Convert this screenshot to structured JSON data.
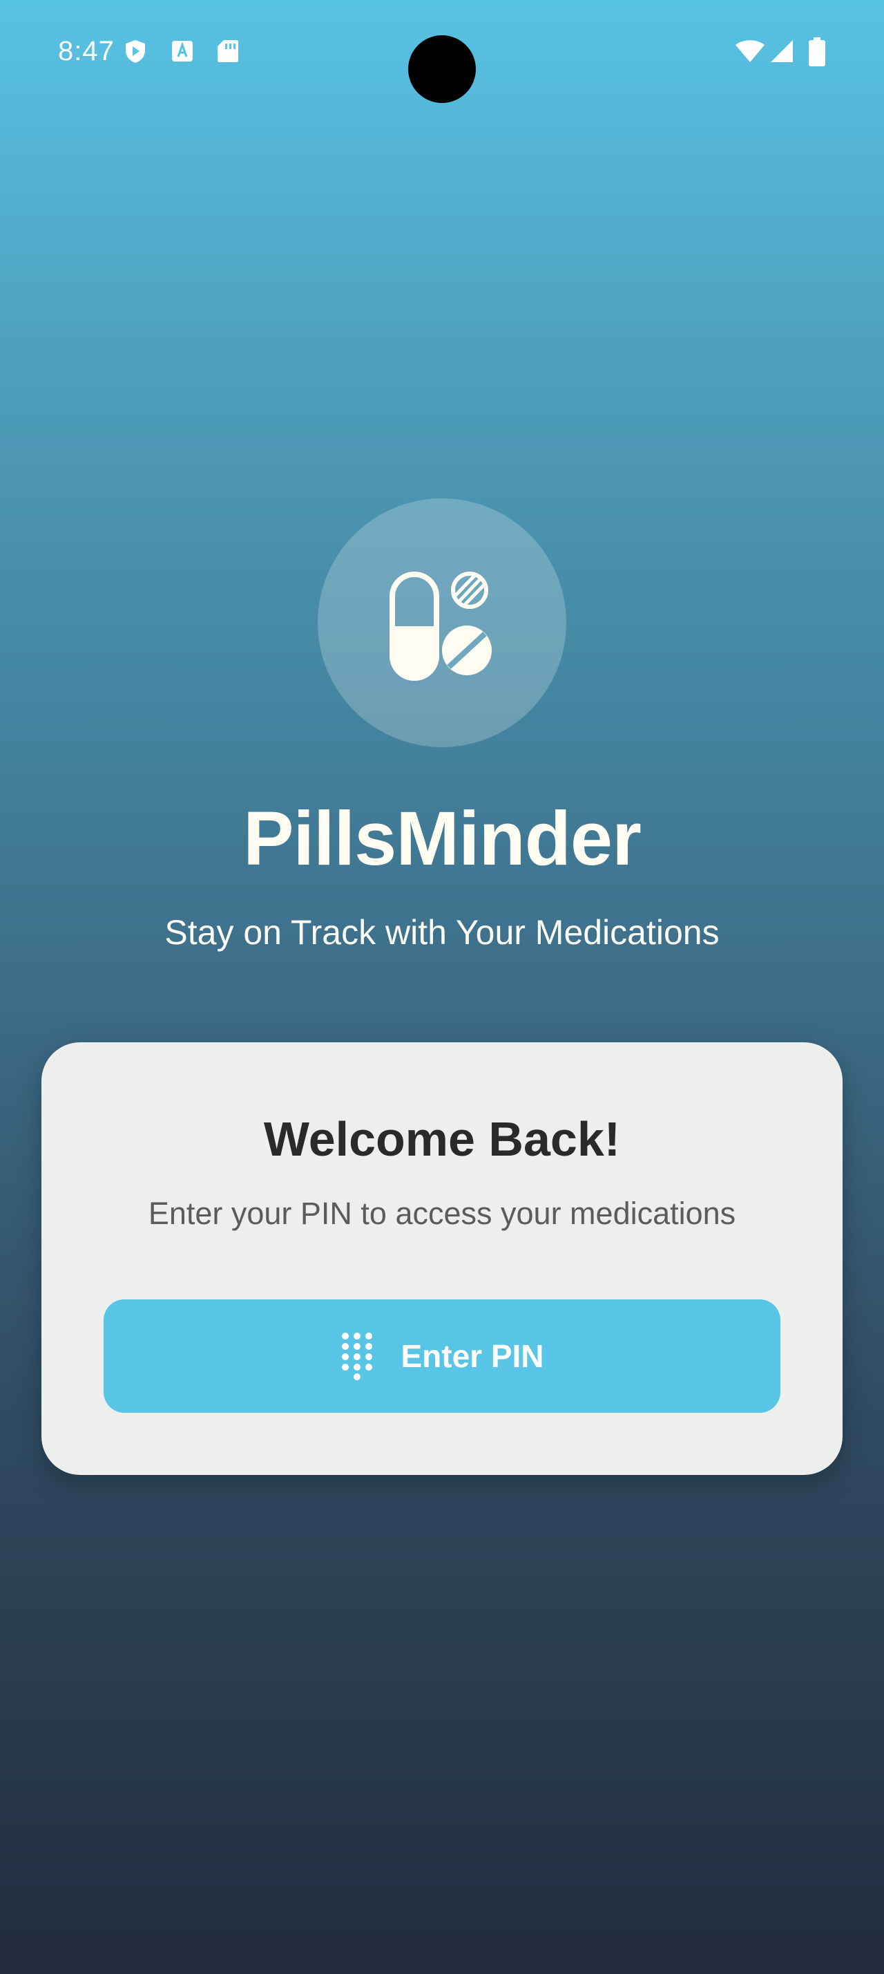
{
  "status_bar": {
    "time": "8:47",
    "left_icons": [
      "shield-icon",
      "keyboard-a-icon",
      "sd-card-icon"
    ],
    "right_icons": [
      "wifi-icon",
      "signal-icon",
      "battery-icon"
    ]
  },
  "app": {
    "logo_icon": "pills-icon",
    "title": "PillsMinder",
    "subtitle": "Stay on Track with Your Medications"
  },
  "card": {
    "title": "Welcome Back!",
    "subtitle": "Enter your PIN to access your medications",
    "button": {
      "icon": "dialpad-icon",
      "label": "Enter PIN"
    }
  },
  "colors": {
    "gradient_top": "#57c3e5",
    "gradient_bottom": "#222b3d",
    "card_background": "#edefed",
    "button_background": "#58c4e6",
    "logo_foreground": "#fffdf2"
  }
}
